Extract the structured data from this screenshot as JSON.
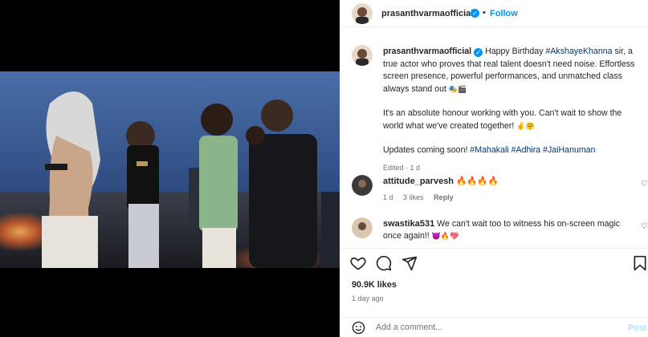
{
  "post": {
    "author": "prasanthvarmaofficial",
    "follow_label": "Follow",
    "dot": "•",
    "caption": {
      "author": "prasanthvarmaofficial",
      "line1_a": "Happy Birthday",
      "line1_tag": "#AkshayeKhanna",
      "line1_b": "sir, a true actor who proves that real talent doesn't need noise. Effortless screen presence, powerful performances, and unmatched class always stand out",
      "line1_emoji": "🎭🎬",
      "para2": "It's an absolute honour working with you. Can't wait to show the world what we've created together!",
      "para2_emoji": "✌️🤗",
      "para3_a": "Updates coming soon!",
      "tag1": "#Mahakali",
      "tag2": "#Adhira",
      "tag3": "#JaiHanuman",
      "meta": "Edited · 1 d"
    },
    "comments": [
      {
        "user": "attitude_parvesh",
        "text": "🔥🔥🔥🔥",
        "time": "1 d",
        "likes": "3 likes",
        "reply": "Reply"
      },
      {
        "user": "swastika531",
        "text": "We can't wait too to witness his on-screen magic once again!!",
        "emoji": "😈🔥💖"
      }
    ],
    "likes": "90.9K likes",
    "ago": "1 day ago",
    "add_comment_placeholder": "Add a comment...",
    "post_label": "Post"
  },
  "icons": {
    "like": "heart-icon",
    "comment": "comment-icon",
    "share": "share-icon",
    "save": "bookmark-icon",
    "emoji": "emoji-icon",
    "verified": "verified-badge-icon"
  },
  "colors": {
    "link": "#0095f6",
    "hashtag": "#00376b",
    "muted": "#737373"
  }
}
